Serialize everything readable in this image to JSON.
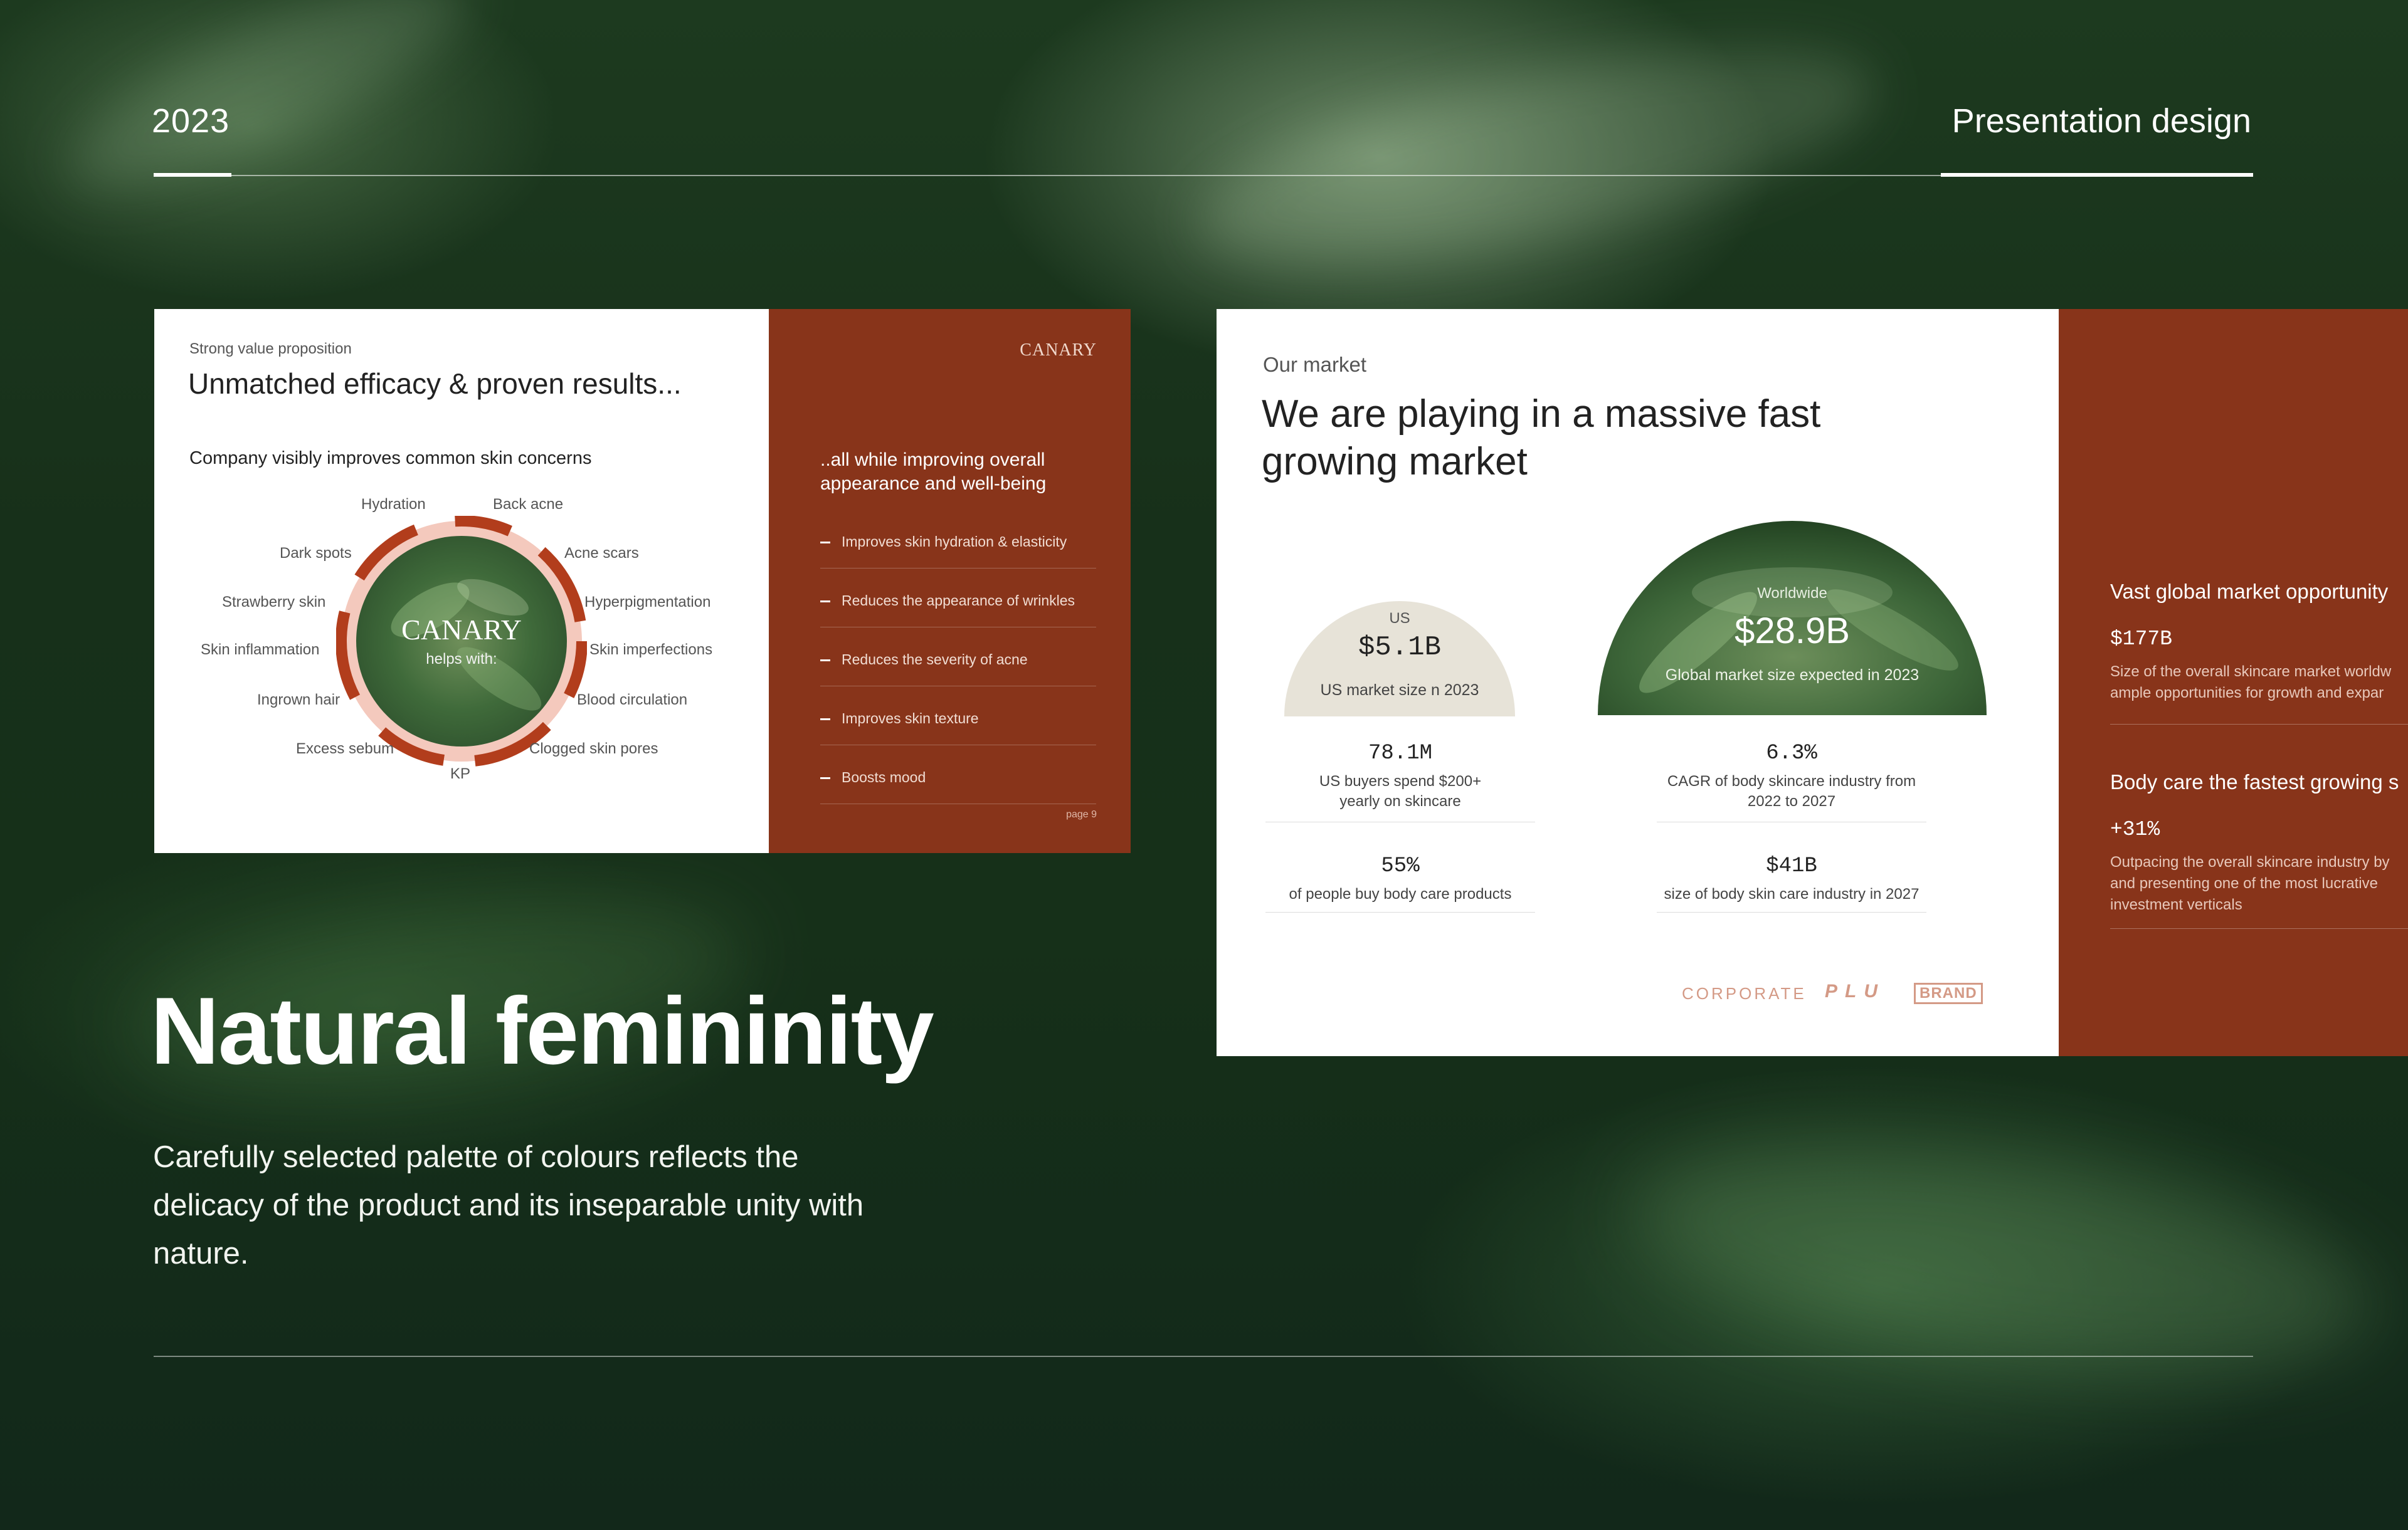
{
  "header": {
    "year": "2023",
    "title": "Presentation design"
  },
  "slide1": {
    "eyebrow": "Strong value proposition",
    "title": "Unmatched efficacy & proven results...",
    "subtitle": "Company visibly improves common skin concerns",
    "wheel_center": {
      "brand": "CANARY",
      "caption": "helps with:"
    },
    "wheel_labels": [
      "Hydration",
      "Back acne",
      "Dark spots",
      "Acne scars",
      "Strawberry skin",
      "Hyperpigmentation",
      "Skin inflammation",
      "Skin imperfections",
      "Ingrown hair",
      "Blood circulation",
      "Excess sebum",
      "Clogged skin pores",
      "KP"
    ],
    "brand": "CANARY",
    "lead": "..all while improving overall appearance and well-being",
    "benefits": [
      "Improves skin hydration & elasticity",
      "Reduces the appearance of wrinkles",
      "Reduces the severity of acne",
      "Improves skin texture",
      "Boosts mood"
    ],
    "page": "page 9"
  },
  "slide2": {
    "eyebrow": "Our market",
    "title": "We are playing in a massive fast growing market",
    "us": {
      "label": "US",
      "value": "$5.1B",
      "caption": "US market size n 2023"
    },
    "worldwide": {
      "label": "Worldwide",
      "value": "$28.9B",
      "caption": "Global market size expected in 2023"
    },
    "stats": [
      {
        "value": "78.1M",
        "desc": "US buyers spend $200+ yearly on skincare"
      },
      {
        "value": "6.3%",
        "desc": "CAGR of body skincare industry from 2022 to 2027"
      },
      {
        "value": "55%",
        "desc": "of people buy body care products"
      },
      {
        "value": "$41B",
        "desc": "size of body skin care industry in 2027"
      }
    ],
    "logos": [
      "CORPORATE",
      "PLU",
      "BRAND"
    ],
    "side": {
      "h1": "Vast global market opportunity",
      "v1": "$177B",
      "p1a": "Size of the overall skincare market worldw",
      "p1b": "ample opportunities for growth and expar",
      "h2": "Body care the fastest growing s",
      "v2": "+31%",
      "p2a": "Outpacing the overall skincare industry by",
      "p2b": "and presenting one of the most lucrative",
      "p2c": "investment verticals"
    }
  },
  "feature": {
    "headline": "Natural femininity",
    "body": "Carefully selected palette of colours reflects the delicacy of the product and its inseparable unity with nature."
  },
  "colors": {
    "rust": "#88341a",
    "blush": "#f4c9bd",
    "beige": "#e7e3d8",
    "forest": "#1d3a1f"
  }
}
